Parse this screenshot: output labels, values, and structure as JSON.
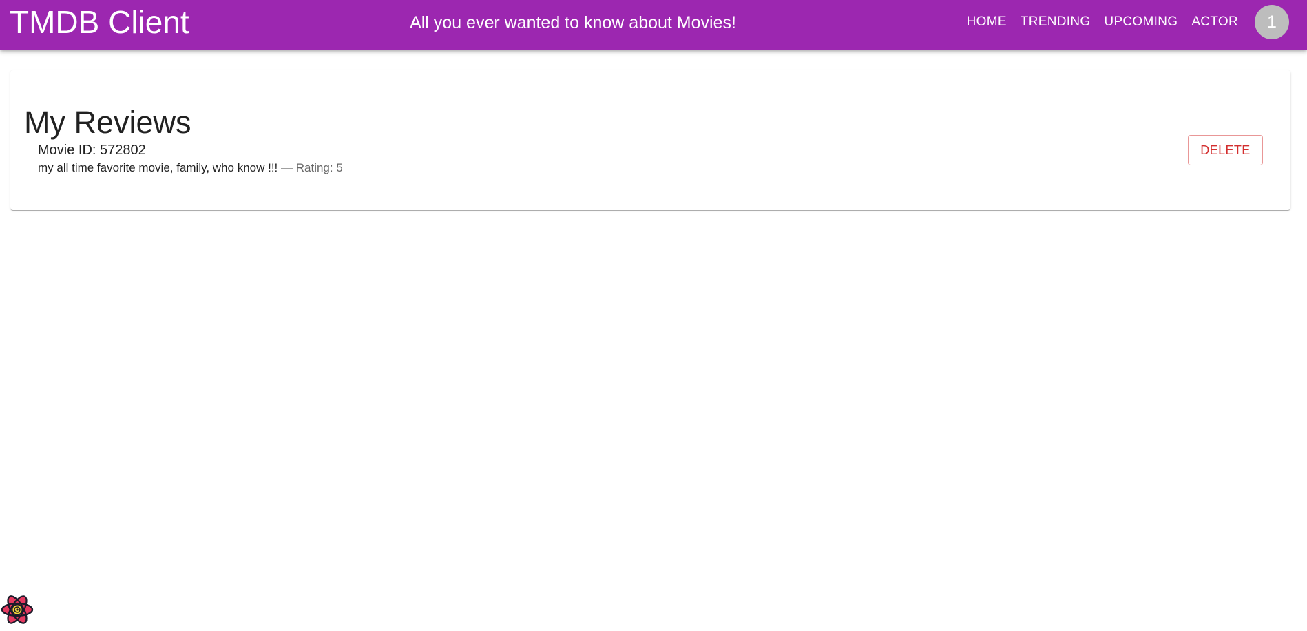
{
  "header": {
    "brand": "TMDB Client",
    "tagline": "All you ever wanted to know about Movies!",
    "nav": [
      "HOME",
      "TRENDING",
      "UPCOMING",
      "ACTOR"
    ],
    "avatar_label": "1",
    "color": "#9c27b0"
  },
  "main": {
    "title": "My Reviews",
    "reviews": [
      {
        "movie_label": "Movie ID: 572802",
        "content": "my all time favorite movie, family, who know !!!",
        "rating_text": " — Rating: 5",
        "delete_label": "DELETE"
      }
    ]
  },
  "devtools": {
    "icon": "react-devtools-icon"
  }
}
